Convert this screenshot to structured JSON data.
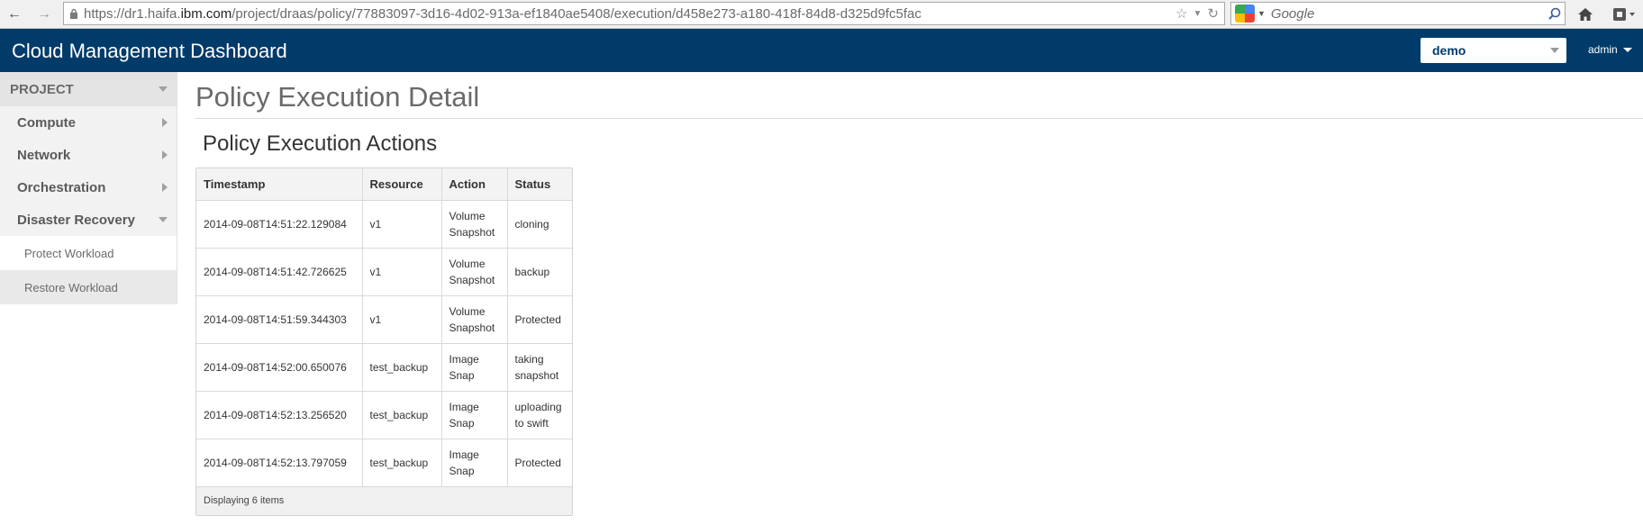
{
  "browser": {
    "url_prefix": "https://dr1.haifa.",
    "url_domain": "ibm.com",
    "url_path": "/project/draas/policy/77883097-3d16-4d02-913a-ef1840ae5408/execution/d458e273-a180-418f-84d8-d325d9fc5fac",
    "search_placeholder": "Google"
  },
  "header": {
    "brand": "Cloud Management Dashboard",
    "project_selected": "demo",
    "user": "admin"
  },
  "sidebar": {
    "section": "PROJECT",
    "items": [
      {
        "label": "Compute"
      },
      {
        "label": "Network"
      },
      {
        "label": "Orchestration"
      },
      {
        "label": "Disaster Recovery"
      }
    ],
    "sub_items": [
      {
        "label": "Protect Workload"
      },
      {
        "label": "Restore Workload"
      }
    ]
  },
  "main": {
    "page_title": "Policy Execution Detail",
    "section_title": "Policy Execution Actions",
    "table": {
      "columns": [
        "Timestamp",
        "Resource",
        "Action",
        "Status"
      ],
      "rows": [
        {
          "timestamp": "2014-09-08T14:51:22.129084",
          "resource": "v1",
          "action": "Volume Snapshot",
          "status": "cloning"
        },
        {
          "timestamp": "2014-09-08T14:51:42.726625",
          "resource": "v1",
          "action": "Volume Snapshot",
          "status": "backup"
        },
        {
          "timestamp": "2014-09-08T14:51:59.344303",
          "resource": "v1",
          "action": "Volume Snapshot",
          "status": "Protected"
        },
        {
          "timestamp": "2014-09-08T14:52:00.650076",
          "resource": "test_backup",
          "action": "Image Snap",
          "status": "taking snapshot"
        },
        {
          "timestamp": "2014-09-08T14:52:13.256520",
          "resource": "test_backup",
          "action": "Image Snap",
          "status": "uploading to swift"
        },
        {
          "timestamp": "2014-09-08T14:52:13.797059",
          "resource": "test_backup",
          "action": "Image Snap",
          "status": "Protected"
        }
      ],
      "footer": "Displaying 6 items"
    }
  },
  "colors": {
    "header_bg": "#003b6a",
    "sidebar_bg": "#f2f2f2"
  }
}
